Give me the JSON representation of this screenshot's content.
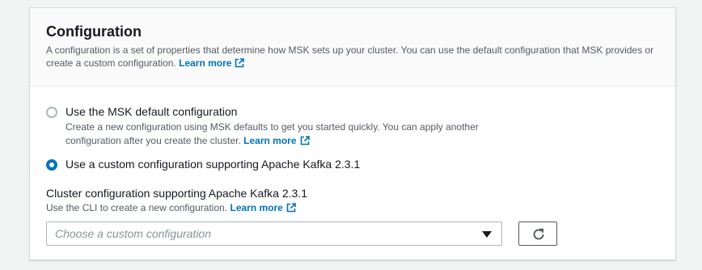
{
  "panel": {
    "title": "Configuration",
    "description": "A configuration is a set of properties that determine how MSK sets up your cluster. You can use the default configuration that MSK provides or create a custom configuration.",
    "learn_more": "Learn more"
  },
  "options": [
    {
      "label": "Use the MSK default configuration",
      "description": "Create a new configuration using MSK defaults to get you started quickly. You can apply another configuration after you create the cluster.",
      "learn_more": "Learn more",
      "selected": false
    },
    {
      "label": "Use a custom configuration supporting Apache Kafka 2.3.1",
      "selected": true
    }
  ],
  "field": {
    "label": "Cluster configuration supporting Apache Kafka 2.3.1",
    "description": "Use the CLI to create a new configuration.",
    "learn_more": "Learn more",
    "placeholder": "Choose a custom configuration",
    "dropdown_icon": "caret-down-icon",
    "refresh_icon": "refresh-icon"
  },
  "colors": {
    "link": "#0073bb",
    "radio_selected": "#0073bb",
    "page_background": "#f2f3f3"
  }
}
